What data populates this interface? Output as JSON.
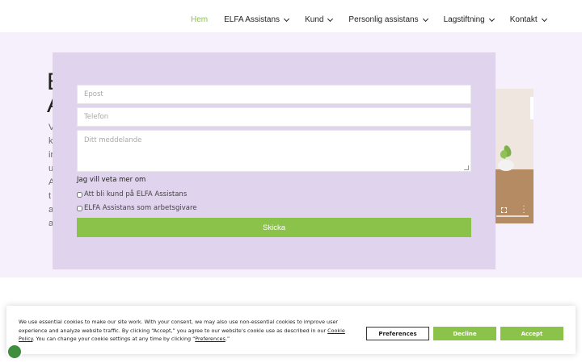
{
  "nav": {
    "items": [
      {
        "label": "Hem",
        "active": true,
        "dropdown": false
      },
      {
        "label": "ELFA Assistans",
        "active": false,
        "dropdown": true
      },
      {
        "label": "Kund",
        "active": false,
        "dropdown": true
      },
      {
        "label": "Personlig assistans",
        "active": false,
        "dropdown": true
      },
      {
        "label": "Lagstiftning",
        "active": false,
        "dropdown": true
      },
      {
        "label": "Kontakt",
        "active": false,
        "dropdown": true
      }
    ]
  },
  "hero": {
    "title": "E\nA",
    "body_lines": [
      "V",
      "k",
      "ir",
      "u",
      "A",
      "t",
      "a",
      "a"
    ]
  },
  "form": {
    "email_placeholder": "Epost",
    "phone_placeholder": "Telefon",
    "message_placeholder": "Ditt meddelande",
    "legend": "Jag vill veta mer om",
    "options": [
      {
        "label": "Att bli kund på ELFA Assistans",
        "checked": false
      },
      {
        "label": "ELFA Assistans som arbetsgivare",
        "checked": false
      }
    ],
    "submit_label": "Skicka"
  },
  "cookie": {
    "text_before_policy": "We use essential cookies to make our site work. With your consent, we may also use non-essential cookies to improve user experience and analyze website traffic. By clicking “Accept,” you agree to our website's cookie use as described in our ",
    "policy_link": "Cookie Policy",
    "text_after_policy": ". You can change your cookie settings at any time by clicking “",
    "preferences_link": "Preferences",
    "text_end": ".”",
    "preferences_button": "Preferences",
    "decline_button": "Decline",
    "accept_button": "Accept"
  },
  "colors": {
    "accent_green": "#8bc34a",
    "form_panel": "#e0d3ee",
    "page_band": "#f6f0fc"
  },
  "icons": {
    "nav_dropdown": "chevron-down-icon",
    "video_fullscreen": "fullscreen-icon",
    "video_more": "more-vertical-icon",
    "chat": "chat-bubble-icon"
  }
}
